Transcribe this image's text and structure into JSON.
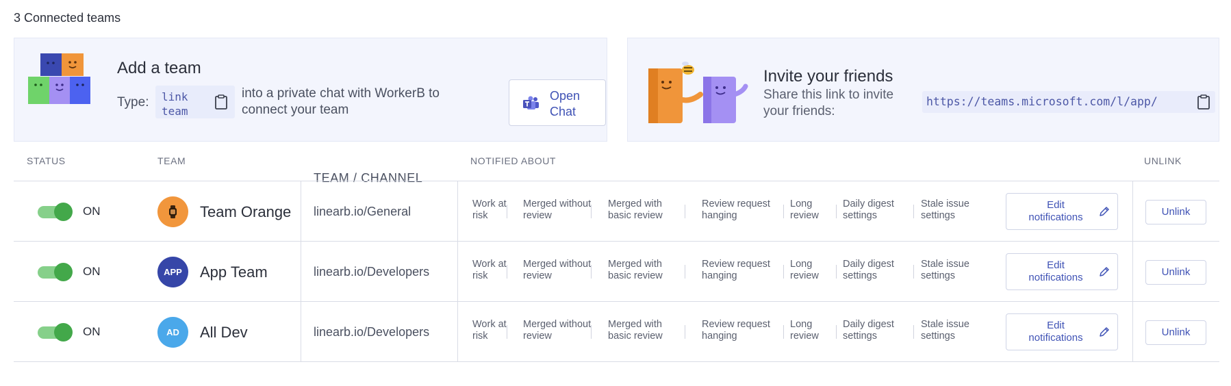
{
  "header": {
    "title": "3 Connected teams"
  },
  "add_team": {
    "title": "Add a team",
    "type_label": "Type:",
    "command": "link team",
    "description": "into a private chat with WorkerB to connect your team",
    "open_chat_label": "Open Chat",
    "copy_icon": "clipboard-icon",
    "teams_icon": "microsoft-teams-icon"
  },
  "invite": {
    "title": "Invite your friends",
    "description": "Share this link to invite your friends:",
    "link": "https://teams.microsoft.com/l/app/",
    "copy_icon": "clipboard-icon"
  },
  "table": {
    "headers": {
      "status": "STATUS",
      "team": "TEAM",
      "channel": "TEAM / CHANNEL",
      "notified": "NOTIFIED ABOUT",
      "unlink": "UNLINK"
    },
    "notification_types": [
      "Work at risk",
      "Merged without review",
      "Merged with basic review",
      "Review request hanging",
      "Long review",
      "Daily digest settings",
      "Stale issue settings"
    ],
    "edit_label": "Edit notifications",
    "unlink_label": "Unlink",
    "rows": [
      {
        "status": "ON",
        "avatar_text": "",
        "avatar_icon": "watch-icon",
        "avatar_color": "#f1963c",
        "team": "Team Orange",
        "channel": "linearb.io/General"
      },
      {
        "status": "ON",
        "avatar_text": "APP",
        "avatar_color": "#3646a8",
        "team": "App Team",
        "channel": "linearb.io/Developers"
      },
      {
        "status": "ON",
        "avatar_text": "AD",
        "avatar_color": "#4aa8ea",
        "team": "All Dev",
        "channel": "linearb.io/Developers"
      }
    ]
  },
  "colors": {
    "accent": "#3f52b5",
    "toggle_on": "#43a84a",
    "card_bg": "#f3f5fd"
  }
}
